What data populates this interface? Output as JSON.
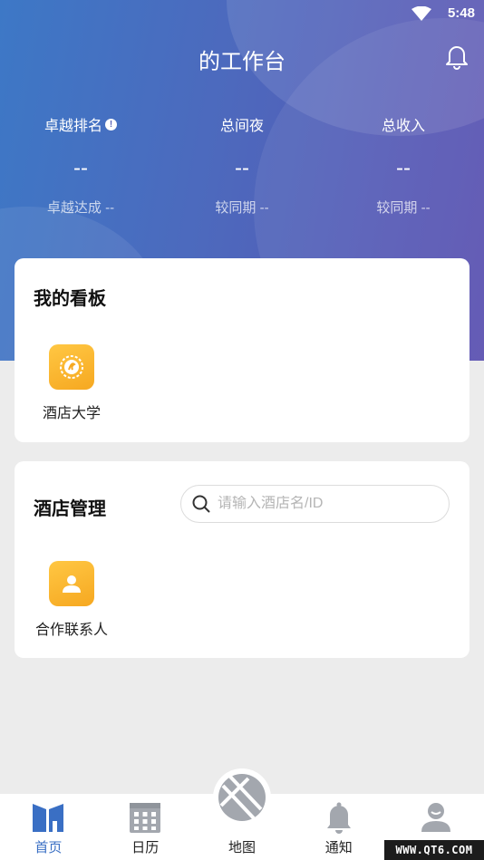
{
  "status_bar": {
    "time": "5:48"
  },
  "header": {
    "title": "的工作台"
  },
  "stats": [
    {
      "label": "卓越排名",
      "value": "--",
      "sub": "卓越达成 --",
      "has_info": true
    },
    {
      "label": "总间夜",
      "value": "--",
      "sub": "较同期 --"
    },
    {
      "label": "总收入",
      "value": "--",
      "sub": "较同期 --"
    }
  ],
  "dashboard": {
    "title": "我的看板",
    "apps": [
      {
        "label": "酒店大学",
        "icon": "university-badge-icon"
      }
    ]
  },
  "hotel_mgmt": {
    "title": "酒店管理",
    "search_placeholder": "请输入酒店名/ID",
    "apps": [
      {
        "label": "合作联系人",
        "icon": "contact-person-icon"
      }
    ]
  },
  "tabbar": {
    "items": [
      {
        "label": "首页",
        "icon": "home-icon",
        "active": true
      },
      {
        "label": "日历",
        "icon": "calendar-icon"
      },
      {
        "label": "地图",
        "icon": "map-icon"
      },
      {
        "label": "通知",
        "icon": "bell-icon"
      },
      {
        "label": "",
        "icon": "profile-icon"
      }
    ]
  },
  "colors": {
    "accent": "#3a6fc4",
    "icon_orange": "#f6a821",
    "tab_gray": "#a3a7ae"
  },
  "watermark": "WWW.QT6.COM"
}
